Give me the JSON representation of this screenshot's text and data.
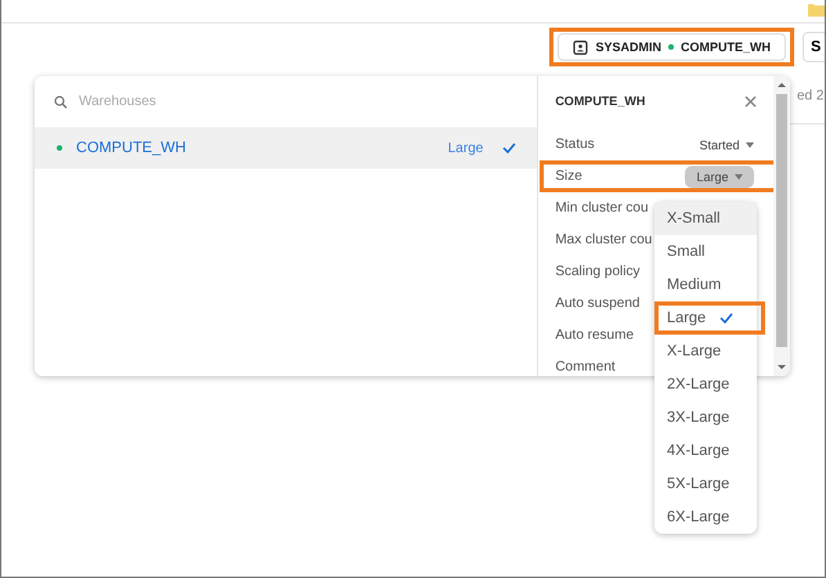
{
  "context": {
    "role": "SYSADMIN",
    "warehouse": "COMPUTE_WH",
    "highlighted": true
  },
  "cut_button": "S",
  "background_text": "ed 2",
  "warehouse_panel": {
    "search": {
      "placeholder": "Warehouses"
    },
    "items": [
      {
        "name": "COMPUTE_WH",
        "size": "Large",
        "color": "#1bb36b",
        "selected": true
      }
    ]
  },
  "details": {
    "title": "COMPUTE_WH",
    "rows": [
      {
        "label": "Status",
        "kind": "select",
        "value": "Started",
        "highlighted": false
      },
      {
        "label": "Size",
        "kind": "pill",
        "value": "Large",
        "highlighted": true
      },
      {
        "label": "Min cluster cou",
        "kind": "plain",
        "highlighted": false
      },
      {
        "label": "Max cluster cou",
        "kind": "plain",
        "highlighted": false
      },
      {
        "label": "Scaling policy",
        "kind": "plain",
        "highlighted": false
      },
      {
        "label": "Auto suspend",
        "kind": "plain",
        "highlighted": false
      },
      {
        "label": "Auto resume",
        "kind": "plain",
        "highlighted": false
      },
      {
        "label": "Comment",
        "kind": "plain",
        "highlighted": false
      }
    ]
  },
  "size_menu": [
    {
      "label": "X-Small",
      "selected": false,
      "hovered": true,
      "highlighted": false
    },
    {
      "label": "Small",
      "selected": false,
      "hovered": false,
      "highlighted": false
    },
    {
      "label": "Medium",
      "selected": false,
      "hovered": false,
      "highlighted": false
    },
    {
      "label": "Large",
      "selected": true,
      "hovered": false,
      "highlighted": true
    },
    {
      "label": "X-Large",
      "selected": false,
      "hovered": false,
      "highlighted": false
    },
    {
      "label": "2X-Large",
      "selected": false,
      "hovered": false,
      "highlighted": false
    },
    {
      "label": "3X-Large",
      "selected": false,
      "hovered": false,
      "highlighted": false
    },
    {
      "label": "4X-Large",
      "selected": false,
      "hovered": false,
      "highlighted": false
    },
    {
      "label": "5X-Large",
      "selected": false,
      "hovered": false,
      "highlighted": false
    },
    {
      "label": "6X-Large",
      "selected": false,
      "hovered": false,
      "highlighted": false
    }
  ]
}
